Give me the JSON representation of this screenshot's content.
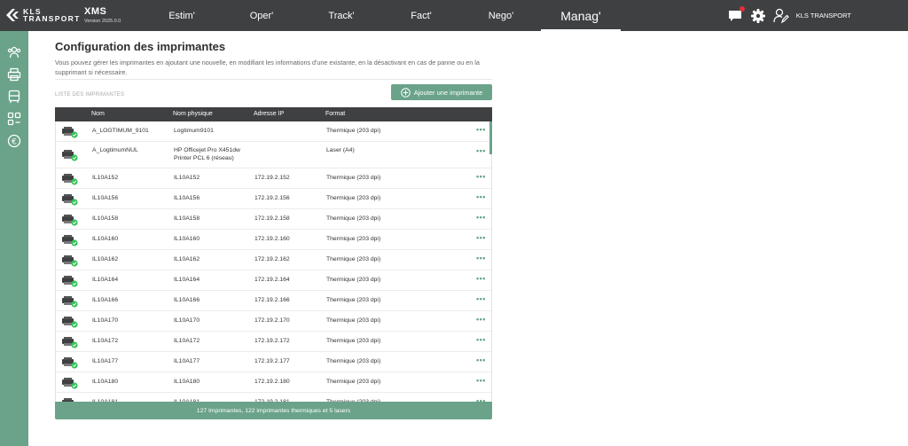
{
  "brand": {
    "logo_line1": "KLS",
    "logo_line2": "TRANSPORT",
    "app_name": "XMS",
    "version": "Version 2025.0.0"
  },
  "nav": [
    "Estim'",
    "Oper'",
    "Track'",
    "Fact'",
    "Nego'",
    "Manag'"
  ],
  "active_nav": "Manag'",
  "user": {
    "name": "KLS TRANSPORT"
  },
  "colors": {
    "accent": "#6aa389",
    "topbar": "#3f4042",
    "notification": "#e0313a",
    "status_ok": "#35c25a"
  },
  "page": {
    "title": "Configuration des imprimantes",
    "description": "Vous pouvez gérer les imprimantes en ajoutant une nouvelle, en modifiant les informations d'une existante, en la désactivant en cas de panne ou en la supprimant si nécessaire.",
    "list_label": "LISTE DES IMPRIMANTES",
    "add_button": "Ajouter une imprimante"
  },
  "table": {
    "columns": [
      "Nom",
      "Nom physique",
      "Adresse IP",
      "Format"
    ],
    "action_label": "•••",
    "rows": [
      {
        "name": "A_LOGTIMUM_9101",
        "physical": "Logtimum9101",
        "ip": "",
        "format": "Thermique (203 dpi)",
        "status": "ok"
      },
      {
        "name": "A_LogtimumNUL",
        "physical": "HP Officejet Pro X451dw Printer PCL 6 (réseau)",
        "ip": "",
        "format": "Laser (A4)",
        "status": "ok"
      },
      {
        "name": "IL10A152",
        "physical": "IL10A152",
        "ip": "172.19.2.152",
        "format": "Thermique (203 dpi)",
        "status": "ok"
      },
      {
        "name": "IL10A156",
        "physical": "IL10A156",
        "ip": "172.19.2.156",
        "format": "Thermique (203 dpi)",
        "status": "ok"
      },
      {
        "name": "IL10A158",
        "physical": "IL10A158",
        "ip": "172.19.2.158",
        "format": "Thermique (203 dpi)",
        "status": "ok"
      },
      {
        "name": "IL10A160",
        "physical": "IL10A160",
        "ip": "172.19.2.160",
        "format": "Thermique (203 dpi)",
        "status": "ok"
      },
      {
        "name": "IL10A162",
        "physical": "IL10A162",
        "ip": "172.19.2.162",
        "format": "Thermique (203 dpi)",
        "status": "ok"
      },
      {
        "name": "IL10A164",
        "physical": "IL10A164",
        "ip": "172.19.2.164",
        "format": "Thermique (203 dpi)",
        "status": "ok"
      },
      {
        "name": "IL10A166",
        "physical": "IL10A166",
        "ip": "172.19.2.166",
        "format": "Thermique (203 dpi)",
        "status": "ok"
      },
      {
        "name": "IL10A170",
        "physical": "IL10A170",
        "ip": "172.19.2.170",
        "format": "Thermique (203 dpi)",
        "status": "ok"
      },
      {
        "name": "IL10A172",
        "physical": "IL10A172",
        "ip": "172.19.2.172",
        "format": "Thermique (203 dpi)",
        "status": "ok"
      },
      {
        "name": "IL10A177",
        "physical": "IL10A177",
        "ip": "172.19.2.177",
        "format": "Thermique (203 dpi)",
        "status": "ok"
      },
      {
        "name": "IL10A180",
        "physical": "IL10A180",
        "ip": "172.19.2.180",
        "format": "Thermique (203 dpi)",
        "status": "ok"
      },
      {
        "name": "IL10A181",
        "physical": "IL10A181",
        "ip": "172.19.2.181",
        "format": "Thermique (203 dpi)",
        "status": "ok"
      }
    ],
    "footer": "127 Imprimantes, 122 imprimantes thermiques et 5 lasers"
  },
  "sidebar": [
    "users-group-icon",
    "printer-icon",
    "truck-icon",
    "apps-grid-icon",
    "euro-icon"
  ]
}
